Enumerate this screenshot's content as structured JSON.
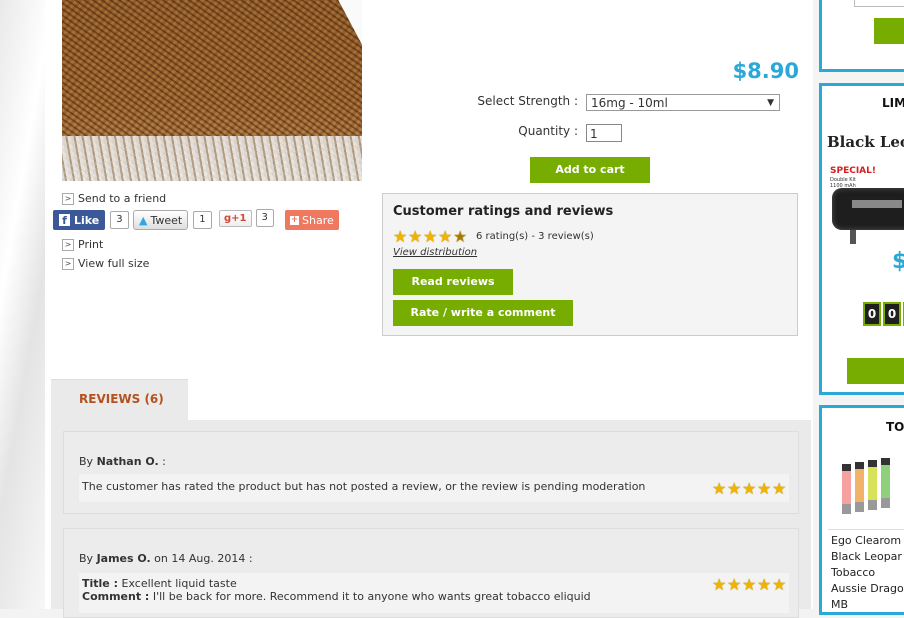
{
  "product": {
    "links": {
      "send_friend": "Send to a friend",
      "print": "Print",
      "view_full": "View full size"
    },
    "social": {
      "like_label": "Like",
      "like_count": "3",
      "tweet_label": "Tweet",
      "tweet_count": "1",
      "gplus_label": "g+1",
      "gplus_count": "3",
      "share_label": "Share"
    },
    "price": "$8.90",
    "strength_label": "Select Strength :",
    "strength_value": "16mg - 10ml",
    "quantity_label": "Quantity :",
    "quantity_value": "1",
    "add_to_cart": "Add to cart"
  },
  "ratings": {
    "title": "Customer ratings and reviews",
    "average_stars": 4.5,
    "summary": "6 rating(s) - 3 review(s)",
    "view_distribution": "View distribution",
    "read_reviews": "Read reviews",
    "rate_write": "Rate / write a comment"
  },
  "tabs": {
    "reviews": "REVIEWS (6)"
  },
  "reviews": [
    {
      "by_prefix": "By",
      "author": "Nathan O.",
      "date_text": " :",
      "text": "The customer has rated the product but has not posted a review, or the review is pending moderation",
      "stars": 5
    },
    {
      "by_prefix": "By",
      "author": "James O.",
      "date_text": " on 14 Aug. 2014 :",
      "title_label": "Title :",
      "title": "Excellent liquid taste",
      "comment_label": "Comment :",
      "comment": "I'll be back for more. Recommend it to anyone who wants great tobacco eliquid",
      "stars": 5
    }
  ],
  "sidebar": {
    "box2_title": "LIM",
    "box2_product": "Black Leop",
    "box2_special": "SPECIAL!",
    "box2_special_sub": "Double Kit",
    "box2_special_sub2": "1100 mAh",
    "box2_price": "$",
    "box2_counter": [
      "0",
      "0"
    ],
    "box3_title": "TO",
    "box3_list": [
      "Ego Clearom",
      "Black Leopar",
      "Tobacco",
      "Aussie Drago",
      "MB"
    ]
  },
  "colors": {
    "accent_green": "#76ad00",
    "price_blue": "#2aa8d8",
    "tab_orange": "#b3521f"
  }
}
